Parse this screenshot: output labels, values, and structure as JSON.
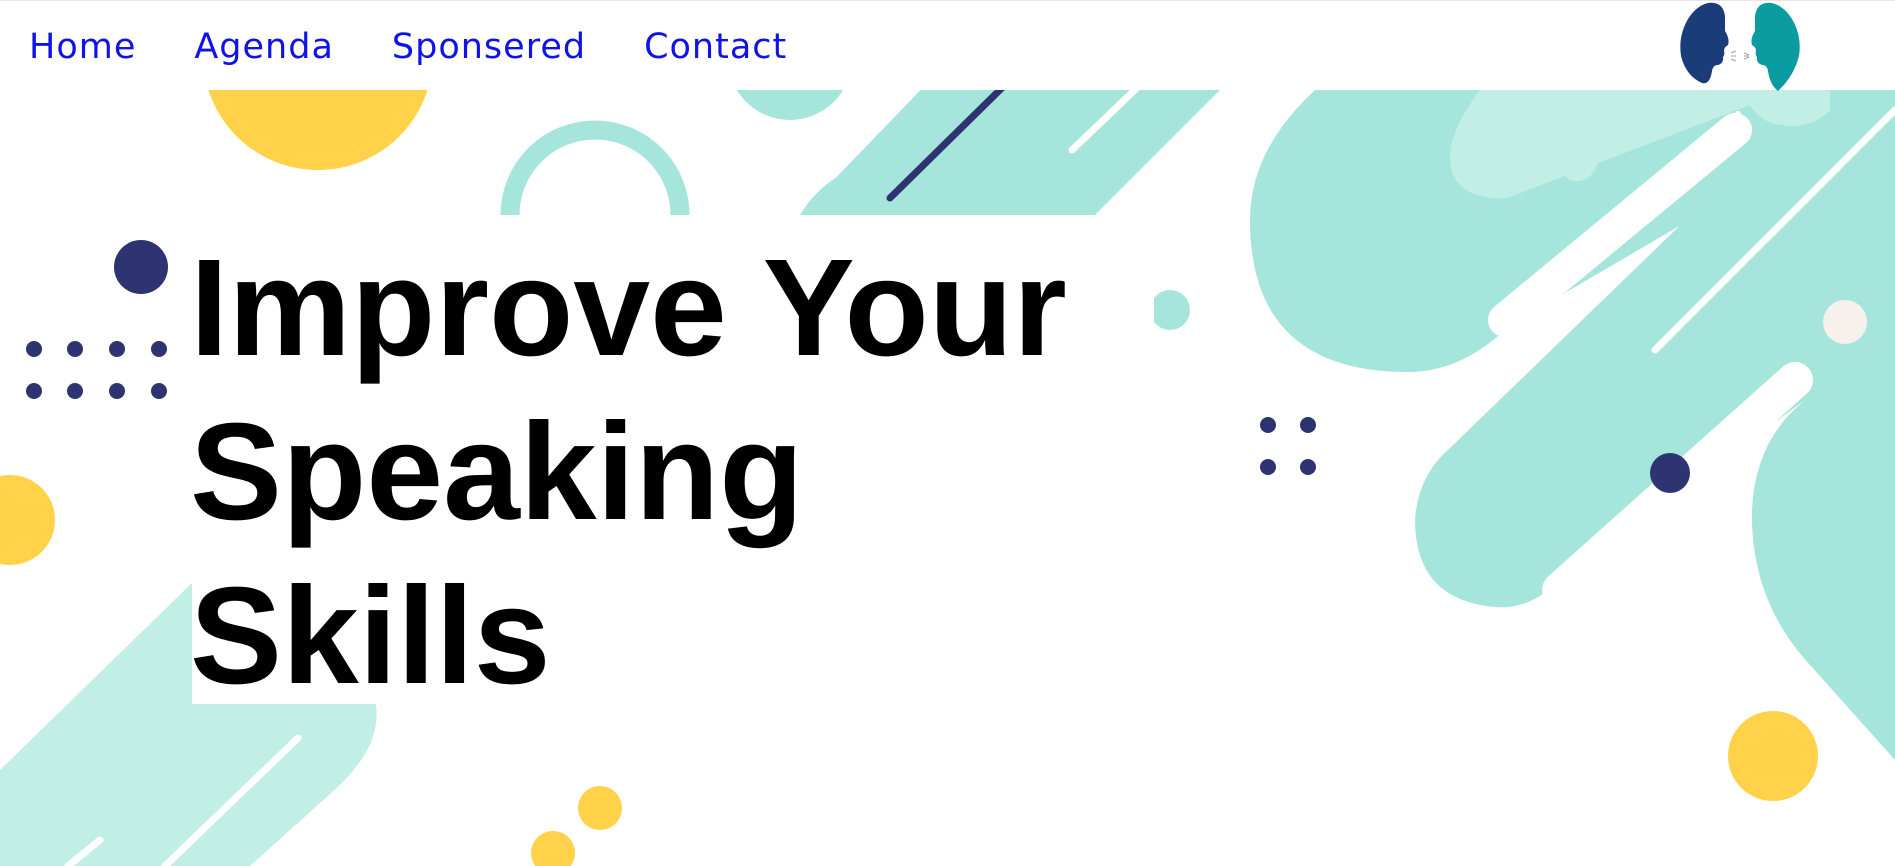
{
  "nav": {
    "items": [
      {
        "label": "Home"
      },
      {
        "label": "Agenda"
      },
      {
        "label": "Sponsered"
      },
      {
        "label": "Contact"
      }
    ]
  },
  "hero": {
    "title_lines": [
      "Improve Your",
      "Speaking",
      "Skills"
    ]
  },
  "colors": {
    "nav_link": "#0f13e8",
    "mint": "#a6e5dc",
    "mint_light": "#c2efe5",
    "yellow": "#ffd24a",
    "navy": "#2e3372",
    "logo_left": "#1a3d7a",
    "logo_right": "#0a9ca0"
  },
  "icons": {
    "logo": "two-faces-talking-icon"
  }
}
